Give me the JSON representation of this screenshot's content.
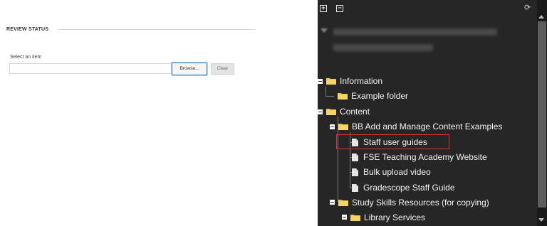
{
  "review": {
    "section_title": "REVIEW STATUS",
    "select_label": "Select an item",
    "input_value": "",
    "browse_label": "Browse...",
    "clear_label": "Clear"
  },
  "tree_panel": {
    "expand_all_symbol": "+",
    "collapse_all_symbol": "−",
    "refresh_symbol": "⟳",
    "items": [
      {
        "label": "Information",
        "type": "folder"
      },
      {
        "label": "Example folder",
        "type": "folder"
      },
      {
        "label": "Content",
        "type": "folder"
      },
      {
        "label": "BB Add and Manage Content Examples",
        "type": "folder"
      },
      {
        "label": "Staff user guides",
        "type": "document",
        "highlighted": true
      },
      {
        "label": "FSE Teaching Academy Website",
        "type": "document"
      },
      {
        "label": "Bulk upload video",
        "type": "document"
      },
      {
        "label": "Gradescope Staff Guide",
        "type": "document"
      },
      {
        "label": "Study Skills Resources (for copying)",
        "type": "folder"
      },
      {
        "label": "Library Services",
        "type": "folder"
      }
    ]
  },
  "colors": {
    "panel_bg": "#262626",
    "highlight": "#e03030",
    "folder": "#e9c24a",
    "browse_border": "#2e7bbf"
  }
}
